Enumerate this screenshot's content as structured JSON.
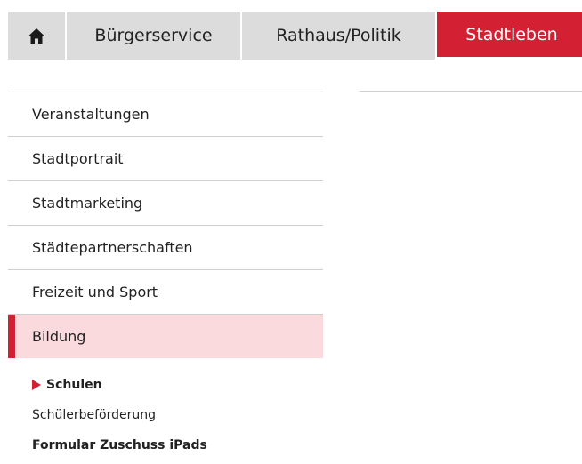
{
  "colors": {
    "accent": "#d42033",
    "tab_background": "#dcdcdc",
    "active_item_background": "#fadadd",
    "divider": "#cfcfcf"
  },
  "topnav": {
    "home_icon": "home-icon",
    "tabs": [
      {
        "label": "Bürgerservice"
      },
      {
        "label": "Rathaus/Politik"
      },
      {
        "label": "Stadtleben",
        "active": true
      }
    ]
  },
  "sidebar": {
    "items": [
      {
        "label": "Veranstaltungen"
      },
      {
        "label": "Stadtportrait"
      },
      {
        "label": "Stadtmarketing"
      },
      {
        "label": "Städtepartnerschaften"
      },
      {
        "label": "Freizeit und Sport"
      },
      {
        "label": "Bildung",
        "active": true
      }
    ],
    "subitems": [
      {
        "label": "Schulen",
        "current": true
      },
      {
        "label": "Schülerbeförderung"
      },
      {
        "label": "Formular Zuschuss iPads"
      }
    ]
  }
}
